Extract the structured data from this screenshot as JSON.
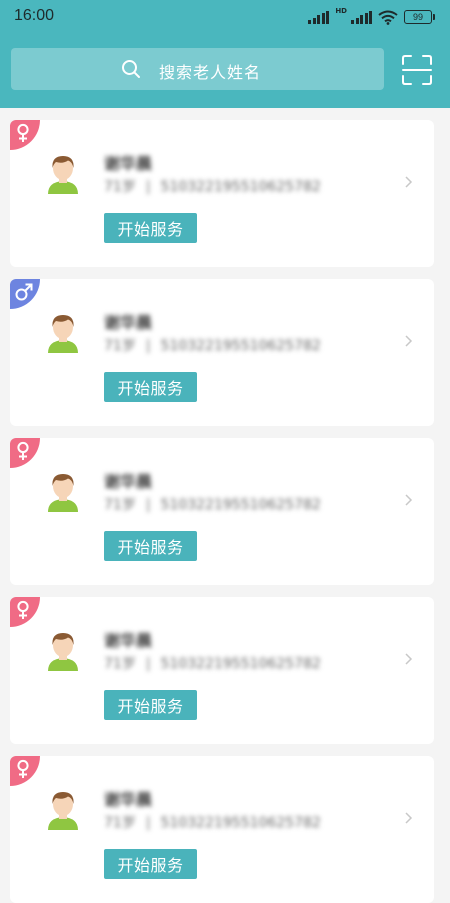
{
  "status_bar": {
    "time": "16:00",
    "battery": "99",
    "network": "HD"
  },
  "search": {
    "placeholder": "搜索老人姓名"
  },
  "cards": [
    {
      "gender": "female",
      "name": "谢华晨",
      "age": "71岁",
      "id_number": "510322195510625782",
      "button": "开始服务"
    },
    {
      "gender": "male",
      "name": "谢华晨",
      "age": "71岁",
      "id_number": "510322195510625782",
      "button": "开始服务"
    },
    {
      "gender": "female",
      "name": "谢华晨",
      "age": "71岁",
      "id_number": "510322195510625782",
      "button": "开始服务"
    },
    {
      "gender": "female",
      "name": "谢华晨",
      "age": "71岁",
      "id_number": "510322195510625782",
      "button": "开始服务"
    },
    {
      "gender": "female",
      "name": "谢华晨",
      "age": "71岁",
      "id_number": "510322195510625782",
      "button": "开始服务"
    }
  ],
  "colors": {
    "header": "#4ab7be",
    "button": "#4ab3bb",
    "female": "#f06b85",
    "male": "#6d84e0"
  }
}
